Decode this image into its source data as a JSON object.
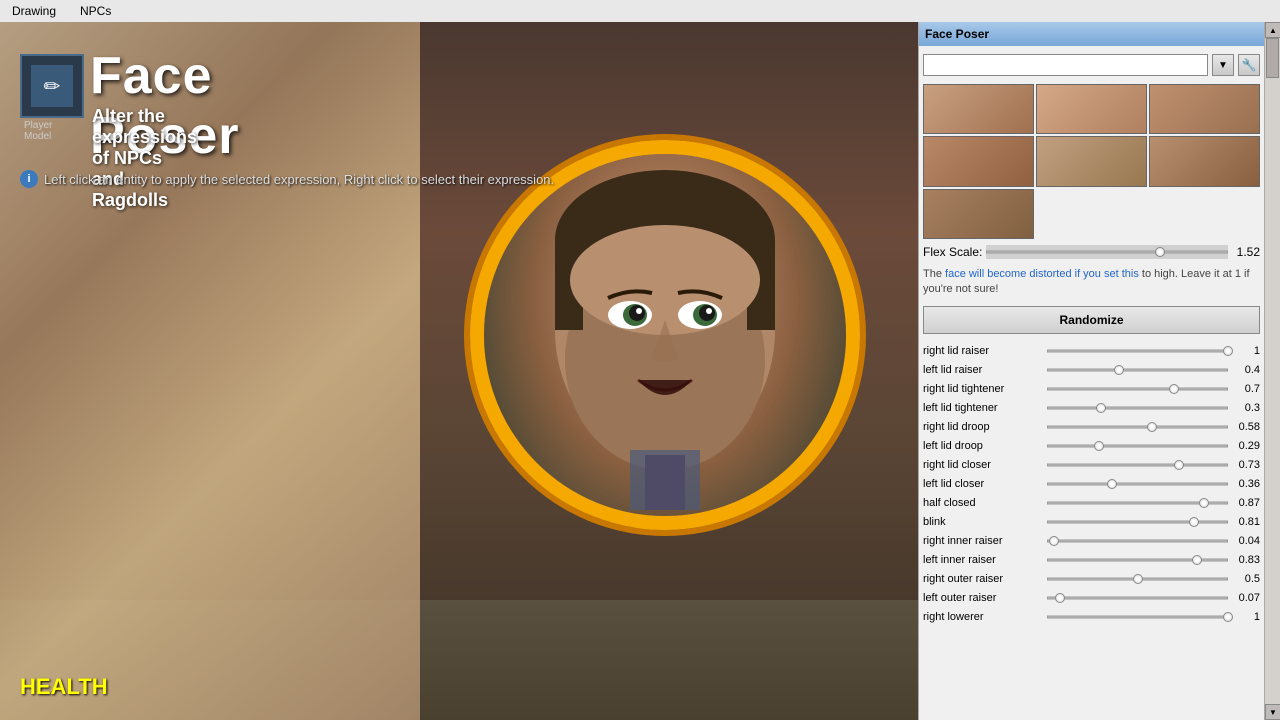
{
  "menubar": {
    "items": [
      "Drawing",
      "NPCs"
    ]
  },
  "tool": {
    "title": "Face Poser",
    "subtitle": "Alter the expressions of NPCs and Ragdolls",
    "player_model_label": "Player Model",
    "icon_symbol": "✏"
  },
  "info_bar": {
    "text": "Left click an entity to apply the selected expression, Right click to select their expression."
  },
  "health": {
    "label": "HEALTH"
  },
  "panel": {
    "title": "Face Poser",
    "dropdown_placeholder": "",
    "flex_scale_label": "Flex Scale:",
    "flex_scale_value": "1.52",
    "flex_scale_percent": 72,
    "warning_text": "The face will become distorted if you set this to high. Leave it at 1 if you're not sure!",
    "randomize_label": "Randomize",
    "sliders": [
      {
        "name": "right lid raiser",
        "value": 1.0,
        "percent": 100
      },
      {
        "name": "left lid raiser",
        "value": 0.4,
        "percent": 40
      },
      {
        "name": "right lid tightener",
        "value": 0.7,
        "percent": 70
      },
      {
        "name": "left lid tightener",
        "value": 0.3,
        "percent": 30
      },
      {
        "name": "right lid droop",
        "value": 0.58,
        "percent": 58
      },
      {
        "name": "left lid droop",
        "value": 0.29,
        "percent": 29
      },
      {
        "name": "right lid closer",
        "value": 0.73,
        "percent": 73
      },
      {
        "name": "left lid closer",
        "value": 0.36,
        "percent": 36
      },
      {
        "name": "half closed",
        "value": 0.87,
        "percent": 87
      },
      {
        "name": "blink",
        "value": 0.81,
        "percent": 81
      },
      {
        "name": "right inner raiser",
        "value": 0.04,
        "percent": 4
      },
      {
        "name": "left inner raiser",
        "value": 0.83,
        "percent": 83
      },
      {
        "name": "right outer raiser",
        "value": 0.5,
        "percent": 50
      },
      {
        "name": "left outer raiser",
        "value": 0.07,
        "percent": 7
      },
      {
        "name": "right lowerer",
        "value": 1.0,
        "percent": 100
      }
    ]
  }
}
